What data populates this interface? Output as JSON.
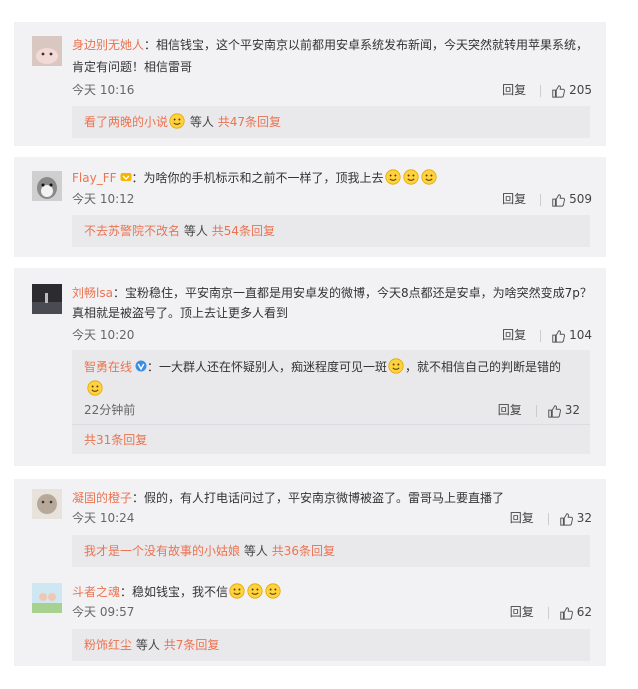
{
  "colors": {
    "accent": "#eb7350",
    "card_bg": "#f2f2f5",
    "subbox_bg": "#e9e9ec"
  },
  "icons": {
    "like": "thumbs-up-icon",
    "emoji": "smiley-emoji-icon",
    "verified": "verified-v-icon"
  },
  "comments": [
    {
      "user": "身边别无她人",
      "text_line1": "：相信钱宝，这个平安南京以前都用安卓系统发布新闻，今天突然就转用苹果系统，",
      "text_line2": "肯定有问题！相信雷哥",
      "time": "今天 10:16",
      "reply_label": "回复",
      "likes": "205",
      "sub_user": "看了两晚的小说",
      "sub_mid": "等人",
      "sub_count": "共47条回复"
    },
    {
      "user": "Flay_FF",
      "text_line1": "：为啥你的手机标示和之前不一样了，顶我上去",
      "time": "今天 10:12",
      "reply_label": "回复",
      "likes": "509",
      "sub_user": "不去苏警院不改名",
      "sub_mid": "等人",
      "sub_count": "共54条回复"
    },
    {
      "user": "刘畅lsa",
      "text_line1": "：宝粉稳住，平安南京一直都是用安卓发的微博，今天8点都还是安卓，为啥突然变成7p？",
      "text_line2": "真相就是被盗号了。顶上去让更多人看到",
      "time": "今天 10:20",
      "reply_label": "回复",
      "likes": "104",
      "nested_user": "智勇在线",
      "nested_text_a": "：一大群人还在怀疑别人，痴迷程度可见一斑",
      "nested_text_b": "，就不相信自己的判断是错的",
      "nested_time": "22分钟前",
      "nested_reply": "回复",
      "nested_likes": "32",
      "nested_total": "共31条回复"
    },
    {
      "user": "凝固的橙子",
      "text_line1": "：假的，有人打电话问过了，平安南京微博被盗了。雷哥马上要直播了",
      "time": "今天 10:24",
      "reply_label": "回复",
      "likes": "32",
      "sub_user": "我才是一个没有故事的小姑娘",
      "sub_mid": "等人",
      "sub_count": "共36条回复"
    },
    {
      "user": "斗者之魂",
      "text_line1": "：稳如钱宝，我不信",
      "time": "今天 09:57",
      "reply_label": "回复",
      "likes": "62",
      "sub_user": "粉饰红尘",
      "sub_mid": "等人",
      "sub_count": "共7条回复"
    }
  ]
}
